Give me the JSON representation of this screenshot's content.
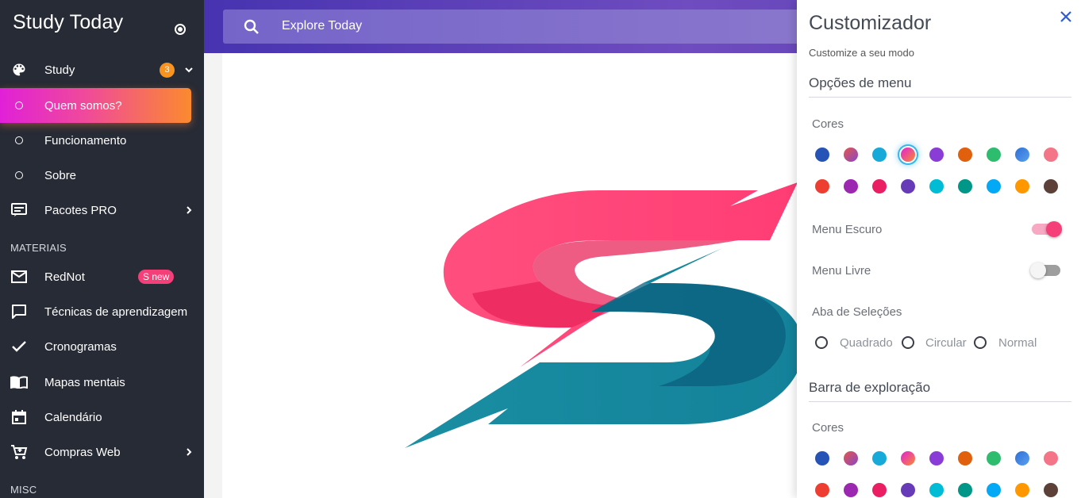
{
  "sidebar": {
    "brand": "Study Today",
    "items": [
      {
        "label": "Study",
        "icon": "palette-icon",
        "badge": "3"
      },
      {
        "label": "Quem somos?"
      },
      {
        "label": "Funcionamento"
      },
      {
        "label": "Sobre"
      },
      {
        "label": "Pacotes PRO",
        "icon": "subtitles-icon"
      }
    ],
    "section_materiais": "MATERIAIS",
    "materiais": [
      {
        "label": "RedNot",
        "icon": "mail-icon",
        "badge": "S new"
      },
      {
        "label": "Técnicas de aprendizagem",
        "icon": "chat-icon"
      },
      {
        "label": "Cronogramas",
        "icon": "check-icon"
      },
      {
        "label": "Mapas mentais",
        "icon": "book-icon"
      },
      {
        "label": "Calendário",
        "icon": "calendar-icon"
      },
      {
        "label": "Compras Web",
        "icon": "cart-icon"
      }
    ],
    "section_misc": "MISC"
  },
  "search": {
    "placeholder": "Explore Today"
  },
  "customizer": {
    "title": "Customizador",
    "subtitle": "Customize a seu modo",
    "menu_section": "Opções de menu",
    "colors_label": "Cores",
    "menu_dark_label": "Menu Escuro",
    "menu_dark_on": true,
    "menu_free_label": "Menu Livre",
    "menu_free_on": false,
    "tabs_label": "Aba de Seleções",
    "tab_options": [
      "Quadrado",
      "Circular",
      "Normal"
    ],
    "explore_section": "Barra de exploração",
    "explore_colors_label": "Cores",
    "palette_row1": [
      "#2653b6",
      "gradient-red-purple",
      "#17a9d8",
      "gradient-pink-orange",
      "#8a3cd6",
      "#e0600e",
      "#2ebd6e",
      "gradient-blue",
      "#f37587"
    ],
    "palette_row2": [
      "#ee3e32",
      "#9c27b0",
      "#e91e63",
      "#673ab7",
      "#00bcd4",
      "#009688",
      "#03a9f4",
      "#ff9800",
      "#5d4037"
    ],
    "selected_swatch": "gradient-pink-orange"
  },
  "colors": {
    "sidebar_bg": "#272b35",
    "accent": "#f43f78",
    "topbar": "#5a3fb4"
  }
}
